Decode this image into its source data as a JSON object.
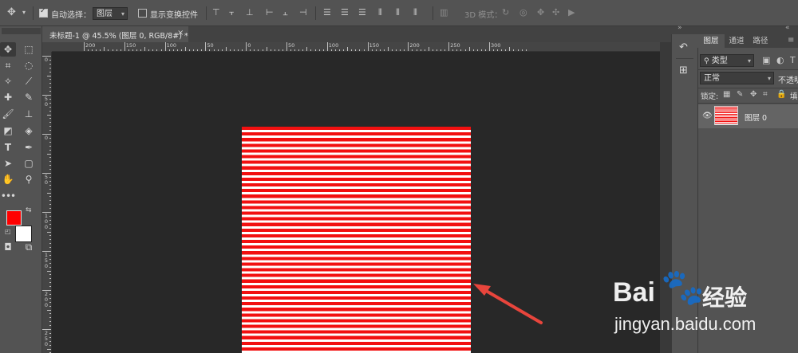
{
  "options_bar": {
    "auto_select_label": "自动选择：",
    "auto_select_checked": true,
    "auto_select_target": "图层",
    "show_transform_label": "显示变换控件",
    "show_transform_checked": false,
    "mode_3d_label": "3D 模式："
  },
  "document_tab": {
    "title": "未标题-1 @ 45.5% (图层 0, RGB/8#) *",
    "close_glyph": "×"
  },
  "ruler": {
    "horizontal_labels": [
      "200",
      "150",
      "100",
      "50",
      "0",
      "50",
      "100",
      "150",
      "200",
      "250",
      "300"
    ],
    "vertical_labels": [
      "0",
      "5\n0",
      "0",
      "5\n0",
      "1\n0\n0",
      "1\n5\n0",
      "2\n0\n0",
      "2\n5\n0"
    ]
  },
  "canvas": {
    "stripe_color": "#f21010",
    "background_color": "#ffffff",
    "stripe_count": 40
  },
  "layers_panel": {
    "tabs": [
      "图层",
      "通道",
      "路径"
    ],
    "active_tab": "图层",
    "kind_filter": "类型",
    "blend_mode": "正常",
    "opacity_label": "不透明",
    "lock_label": "锁定:",
    "fill_label": "填",
    "layers": [
      {
        "name": "图层 0",
        "visible": true
      }
    ]
  },
  "colors": {
    "foreground": "#ff0000",
    "background": "#ffffff",
    "arrow": "#e8453c"
  },
  "watermark": {
    "brand": "Bai",
    "brand_suffix": "经验",
    "url": "jingyan.baidu.com"
  }
}
